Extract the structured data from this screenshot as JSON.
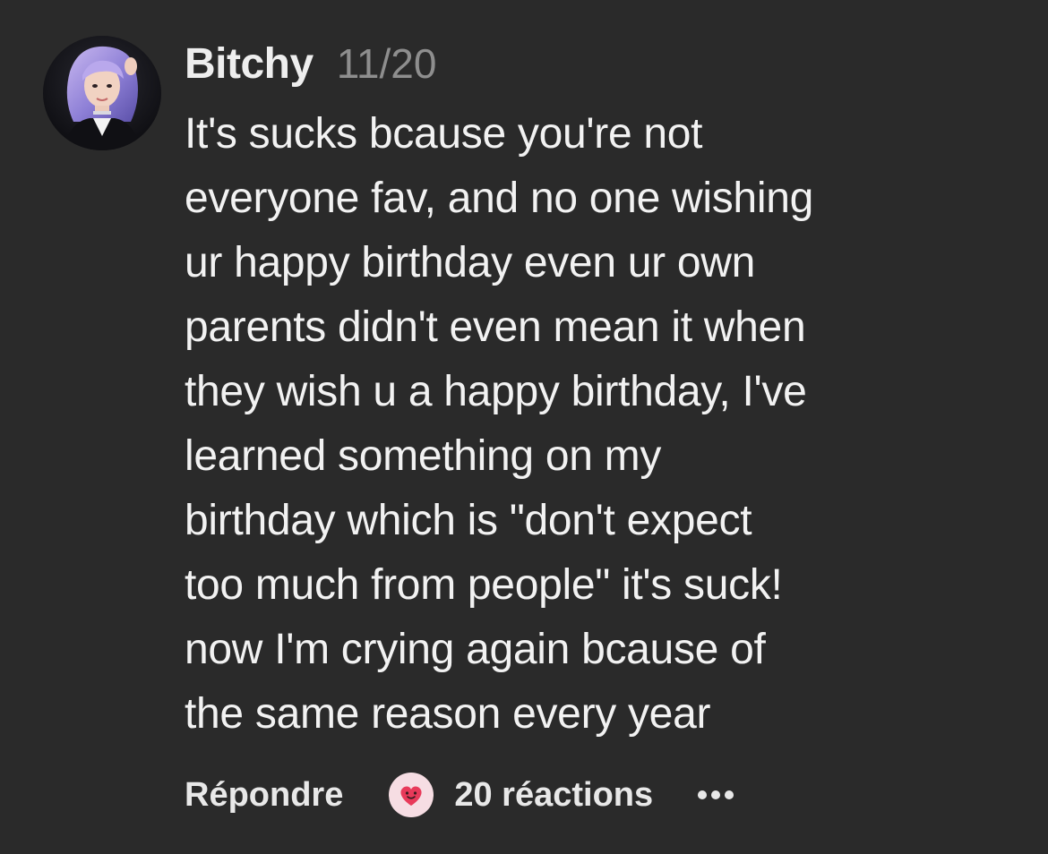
{
  "comment": {
    "username": "Bitchy",
    "date": "11/20",
    "lines": [
      "It's sucks bcause you're not",
      "everyone fav, and no one wishing",
      "ur happy birthday even ur own",
      "parents didn't even mean it when",
      "they wish u a happy birthday, I've",
      "learned something on my",
      "birthday which is \"don't expect",
      "too much from people\" it's suck!",
      "now I'm crying again bcause of",
      "the same reason every year"
    ]
  },
  "actions": {
    "reply_label": "Répondre",
    "reaction_icon": "smiling-heart-face-icon",
    "reactions_label": "20 réactions",
    "more_icon": "more-dots-icon"
  },
  "colors": {
    "background": "#2a2a2a",
    "text": "#f2f2f2",
    "date": "#8e8e8e",
    "reaction_bubble": "#f6dde3",
    "reaction_heart": "#e83a5a"
  }
}
